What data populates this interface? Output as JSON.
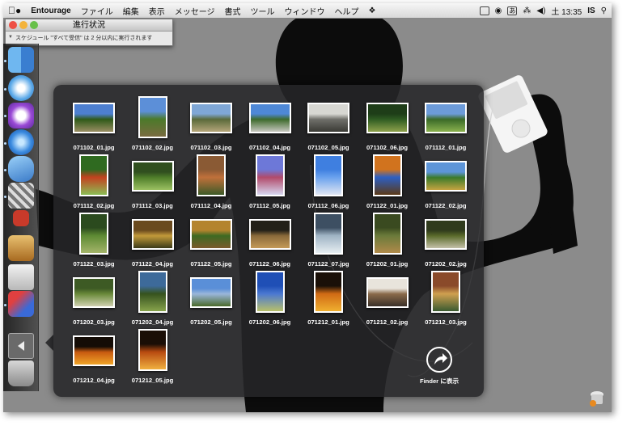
{
  "menubar": {
    "apple_icon": "apple-icon",
    "app_name": "Entourage",
    "menus": [
      "ファイル",
      "編集",
      "表示",
      "メッセージ",
      "書式",
      "ツール",
      "ウィンドウ",
      "ヘルプ"
    ],
    "script_icon": "script-icon",
    "input_badge": "あ",
    "clock": "土 13:35",
    "user": "IS",
    "search_icon": "spotlight-icon"
  },
  "progress_window": {
    "title": "進行状況",
    "message": "スケジュール \"すべて受信\" は 2 分以内に実行されます"
  },
  "dock": {
    "items": [
      "finder-icon",
      "safari-icon",
      "entourage-icon",
      "itunes-icon",
      "dashboard-icon",
      "iphoto-icon",
      "photo-booth-icon",
      "preview-icon",
      "ipod-sync-icon",
      "mail-icon",
      "back-arrow-icon",
      "trash-icon"
    ]
  },
  "stack": {
    "files": [
      {
        "name": "071102_01.jpg",
        "c": [
          "#4d7fd0",
          "#2f5a18",
          "#9a8e63"
        ],
        "o": "l"
      },
      {
        "name": "071102_02.jpg",
        "c": [
          "#5c8fd8",
          "#4b7a2a",
          "#7a6b40"
        ],
        "o": "p"
      },
      {
        "name": "071102_03.jpg",
        "c": [
          "#7fa7d6",
          "#5a6a3a",
          "#b5a67a"
        ],
        "o": "l"
      },
      {
        "name": "071102_04.jpg",
        "c": [
          "#4e88d6",
          "#3d6a2c",
          "#c8c8c0"
        ],
        "o": "l"
      },
      {
        "name": "071102_05.jpg",
        "c": [
          "#d7d7d2",
          "#6f6f6a",
          "#3a3a35"
        ],
        "o": "l"
      },
      {
        "name": "071102_06.jpg",
        "c": [
          "#1e3d18",
          "#2f5c22",
          "#8ea14c"
        ],
        "o": "l"
      },
      {
        "name": "071112_01.jpg",
        "c": [
          "#6c9bd9",
          "#3a6a28",
          "#8ab14f"
        ],
        "o": "l"
      },
      {
        "name": "071112_02.jpg",
        "c": [
          "#2f6a20",
          "#c3421f",
          "#8bbd55"
        ],
        "o": "p"
      },
      {
        "name": "071112_03.jpg",
        "c": [
          "#304f1f",
          "#4f7e2a",
          "#9bc062"
        ],
        "o": "l"
      },
      {
        "name": "071112_04.jpg",
        "c": [
          "#8a5a34",
          "#c0703b",
          "#3d5a28"
        ],
        "o": "p"
      },
      {
        "name": "071112_05.jpg",
        "c": [
          "#6d78d8",
          "#b14a6a",
          "#d7d7f0"
        ],
        "o": "p"
      },
      {
        "name": "071112_06.jpg",
        "c": [
          "#3f7fe0",
          "#6aa2ee",
          "#e0e6f2"
        ],
        "o": "p"
      },
      {
        "name": "071122_01.jpg",
        "c": [
          "#d1731e",
          "#2d5fc2",
          "#5b3a18"
        ],
        "o": "p"
      },
      {
        "name": "071122_02.jpg",
        "c": [
          "#5d95d8",
          "#3b7a2a",
          "#c4a441"
        ],
        "o": "l"
      },
      {
        "name": "071122_03.jpg",
        "c": [
          "#2b4a1e",
          "#5d8a33",
          "#a4b56a"
        ],
        "o": "p"
      },
      {
        "name": "071122_04.jpg",
        "c": [
          "#6a4a1e",
          "#c29a3a",
          "#3b3a18"
        ],
        "o": "l"
      },
      {
        "name": "071122_05.jpg",
        "c": [
          "#b4842e",
          "#3e6a22",
          "#7a5a2a"
        ],
        "o": "l"
      },
      {
        "name": "071122_06.jpg",
        "c": [
          "#222018",
          "#8a6a3a",
          "#c49a58"
        ],
        "o": "l"
      },
      {
        "name": "071122_07.jpg",
        "c": [
          "#3d4f62",
          "#9fb3c4",
          "#e6eef2"
        ],
        "o": "p"
      },
      {
        "name": "071202_01.jpg",
        "c": [
          "#3a4a20",
          "#6a7a3a",
          "#b08a4a"
        ],
        "o": "p"
      },
      {
        "name": "071202_02.jpg",
        "c": [
          "#2f3a1c",
          "#5a6a2a",
          "#c4c0a8"
        ],
        "o": "l"
      },
      {
        "name": "071202_03.jpg",
        "c": [
          "#3d5a24",
          "#6a8a3a",
          "#d0d0b0"
        ],
        "o": "l"
      },
      {
        "name": "071202_04.jpg",
        "c": [
          "#3d6a9a",
          "#36521e",
          "#87a34c"
        ],
        "o": "p"
      },
      {
        "name": "071202_05.jpg",
        "c": [
          "#5a8fd8",
          "#9ab6da",
          "#4a6a2a"
        ],
        "o": "l"
      },
      {
        "name": "071202_06.jpg",
        "c": [
          "#1f4fb6",
          "#4a78d2",
          "#b8c06a"
        ],
        "o": "p"
      },
      {
        "name": "071212_01.jpg",
        "c": [
          "#1a1008",
          "#d06a14",
          "#f0b030"
        ],
        "o": "p"
      },
      {
        "name": "071212_02.jpg",
        "c": [
          "#e8e4dc",
          "#8a6a4a",
          "#3a3028"
        ],
        "o": "l"
      },
      {
        "name": "071212_03.jpg",
        "c": [
          "#8a4a2a",
          "#d0a050",
          "#3a5a30"
        ],
        "o": "p"
      },
      {
        "name": "071212_04.jpg",
        "c": [
          "#140c06",
          "#c85a10",
          "#f0a428"
        ],
        "o": "l"
      },
      {
        "name": "071212_05.jpg",
        "c": [
          "#1a0e06",
          "#b84a10",
          "#f0b040"
        ],
        "o": "p"
      }
    ],
    "finder_label": "Finder に表示"
  },
  "status_icon": "sync-status-icon",
  "colors": {
    "wallpaper": "#8c8c8c",
    "silhouette": "#0c0c0c",
    "stack_bg": "#262628",
    "dock_indicator": "#bfe0ff",
    "close": "#ee4f45",
    "minimize": "#f3b33c",
    "zoom": "#68c04a"
  }
}
